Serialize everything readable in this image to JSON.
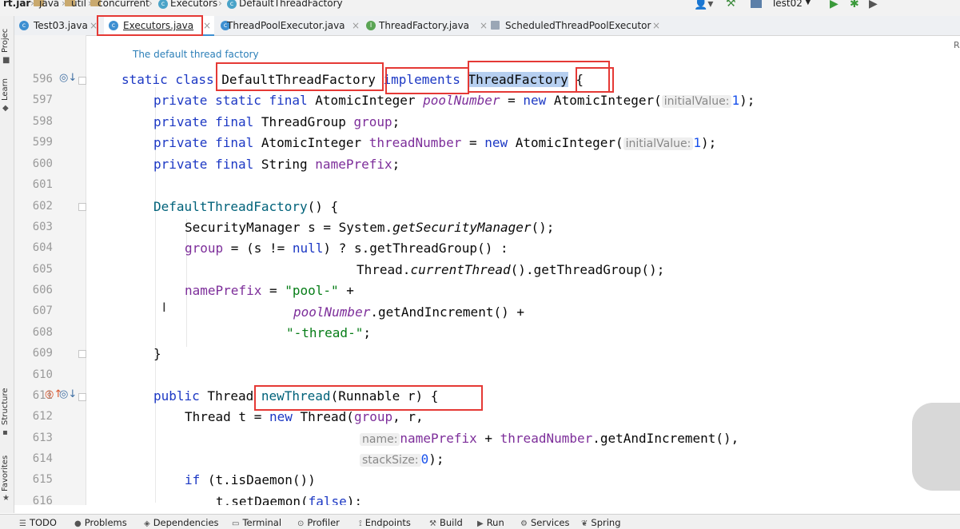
{
  "breadcrumb": [
    {
      "label": "rt.jar",
      "icon": "jar-icon",
      "bold": true
    },
    {
      "label": "java",
      "icon": "folder-icon"
    },
    {
      "label": "util",
      "icon": "folder-icon"
    },
    {
      "label": "concurrent",
      "icon": "folder-icon"
    },
    {
      "label": "Executors",
      "icon": "class-icon"
    },
    {
      "label": "DefaultThreadFactory",
      "icon": "class-icon"
    }
  ],
  "toolbar": {
    "run_config": "Test02"
  },
  "tabs": [
    {
      "label": "Test03.java",
      "active": false
    },
    {
      "label": "Executors.java",
      "active": true
    },
    {
      "label": "ThreadPoolExecutor.java",
      "active": false
    },
    {
      "label": "ThreadFactory.java",
      "active": false
    },
    {
      "label": "ScheduledThreadPoolExecutor",
      "active": false
    }
  ],
  "left_tool_windows": [
    "Projec",
    "Learn",
    "Structure",
    "Favorites"
  ],
  "doc_comment": "The default thread factory",
  "line_numbers": [
    "596",
    "597",
    "598",
    "599",
    "600",
    "601",
    "602",
    "603",
    "604",
    "605",
    "606",
    "607",
    "608",
    "609",
    "610",
    "611",
    "612",
    "613",
    "614",
    "615",
    "616"
  ],
  "code": {
    "l596": {
      "kw1": "static class",
      "cls": "DefaultThreadFactory",
      "kw2": "implements",
      "iface": "ThreadFactory",
      "rest": " {"
    },
    "l597": {
      "kw": "private static final",
      "type": " AtomicInteger ",
      "field": "poolNumber",
      "op": " = ",
      "new": "new",
      "ctor": " AtomicInteger(",
      "hint": "initialValue:",
      "num": "1",
      "end": ");"
    },
    "l598": {
      "kw": "private final",
      "type": " ThreadGroup ",
      "field": "group",
      "end": ";"
    },
    "l599": {
      "kw": "private final",
      "type": " AtomicInteger ",
      "field": "threadNumber",
      "op": " = ",
      "new": "new",
      "ctor": " AtomicInteger(",
      "hint": "initialValue:",
      "num": "1",
      "end": ");"
    },
    "l600": {
      "kw": "private final",
      "type": " String ",
      "field": "namePrefix",
      "end": ";"
    },
    "l602": {
      "mth": "DefaultThreadFactory",
      "rest": "() {"
    },
    "l603": {
      "pre": "SecurityManager s = System.",
      "imth": "getSecurityManager",
      "end": "();"
    },
    "l604": {
      "field": "group",
      "a": " = (s != ",
      "kw": "null",
      "b": ") ? s.getThreadGroup() :"
    },
    "l605": {
      "pre": "Thread.",
      "imth": "currentThread",
      "end": "().getThreadGroup();"
    },
    "l606": {
      "field": "namePrefix",
      "op": " = ",
      "str": "\"pool-\"",
      "end": " +"
    },
    "l607": {
      "ifield": "poolNumber",
      "end": ".getAndIncrement() +"
    },
    "l608": {
      "str": "\"-thread-\"",
      "end": ";"
    },
    "l609": {
      "text": "}"
    },
    "l611": {
      "kw": "public",
      "type": " Thread ",
      "mth": "newThread",
      "rest": "(Runnable r) {"
    },
    "l612": {
      "pre": "Thread t = ",
      "new": "new",
      "mid": " Thread(",
      "field": "group",
      "end": ", r,"
    },
    "l613": {
      "hint": "name:",
      "field1": "namePrefix",
      "op": " + ",
      "field2": "threadNumber",
      "end": ".getAndIncrement(),"
    },
    "l614": {
      "hint": "stackSize:",
      "num": "0",
      "end": ");"
    },
    "l615": {
      "kw": "if",
      "end": " (t.isDaemon())"
    },
    "l616": {
      "pre": "t.setDaemon(",
      "kw": "false",
      "end": ");"
    }
  },
  "editor_corner_mark": "R",
  "bottom_tools": [
    {
      "label": "TODO",
      "icon": "list-icon"
    },
    {
      "label": "Problems",
      "icon": "warning-icon"
    },
    {
      "label": "Dependencies",
      "icon": "layers-icon"
    },
    {
      "label": "Terminal",
      "icon": "terminal-icon"
    },
    {
      "label": "Profiler",
      "icon": "profiler-icon"
    },
    {
      "label": "Endpoints",
      "icon": "endpoints-icon"
    },
    {
      "label": "Build",
      "icon": "hammer-icon"
    },
    {
      "label": "Run",
      "icon": "run-icon"
    },
    {
      "label": "Services",
      "icon": "gear-icon"
    },
    {
      "label": "Spring",
      "icon": "leaf-icon"
    }
  ],
  "colors": {
    "keyword": "#1c38c4",
    "field": "#7d2e9a",
    "string": "#067d17",
    "number": "#1750eb",
    "annotation_box": "#e53935",
    "selection": "#b6cff0"
  }
}
